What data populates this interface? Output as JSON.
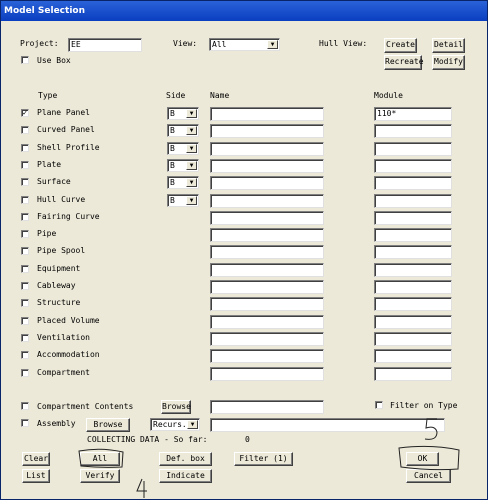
{
  "window": {
    "title": "Model Selection"
  },
  "header": {
    "project_label": "Project:",
    "project_value": "EE",
    "view_label": "View:",
    "view_value": "All",
    "hull_view_label": "Hull View:",
    "use_box_label": "Use Box",
    "create": "Create",
    "detail": "Detail",
    "recreate": "Recreate",
    "modify": "Modify"
  },
  "columns": {
    "type": "Type",
    "side": "Side",
    "name": "Name",
    "module": "Module"
  },
  "rows": [
    {
      "label": "Plane Panel",
      "checked": "✓",
      "side": "B",
      "module": "110*"
    },
    {
      "label": "Curved Panel",
      "checked": "",
      "side": "B",
      "module": ""
    },
    {
      "label": "Shell Profile",
      "checked": "",
      "side": "B",
      "module": ""
    },
    {
      "label": "Plate",
      "checked": "",
      "side": "B",
      "module": ""
    },
    {
      "label": "Surface",
      "checked": "",
      "side": "B",
      "module": ""
    },
    {
      "label": "Hull Curve",
      "checked": "",
      "side": "B",
      "module": ""
    },
    {
      "label": "Fairing Curve",
      "checked": "",
      "module": ""
    },
    {
      "label": "Pipe",
      "checked": "",
      "module": ""
    },
    {
      "label": "Pipe Spool",
      "checked": "",
      "module": ""
    },
    {
      "label": "Equipment",
      "checked": "",
      "module": ""
    },
    {
      "label": "Cableway",
      "checked": "",
      "module": ""
    },
    {
      "label": "Structure",
      "checked": "",
      "module": ""
    },
    {
      "label": "Placed Volume",
      "checked": "",
      "module": ""
    },
    {
      "label": "Ventilation",
      "checked": "",
      "module": ""
    },
    {
      "label": "Accommodation",
      "checked": "",
      "module": ""
    },
    {
      "label": "Compartment",
      "checked": "",
      "module": ""
    }
  ],
  "lower": {
    "compartment_contents": "Compartment Contents",
    "browse_label": "Browse",
    "filter_on_type": "Filter on Type",
    "assembly": "Assembly",
    "assembly_browse": "Browse",
    "recurs": "Recurs.",
    "collecting": "COLLECTING DATA - So far:",
    "count": "0"
  },
  "footer": {
    "clear": "Clear",
    "all": "All",
    "def_box": "Def. box",
    "filter": "Filter (1)",
    "ok": "OK",
    "list": "List",
    "verify": "Verify",
    "indicate": "Indicate",
    "cancel": "Cancel"
  }
}
